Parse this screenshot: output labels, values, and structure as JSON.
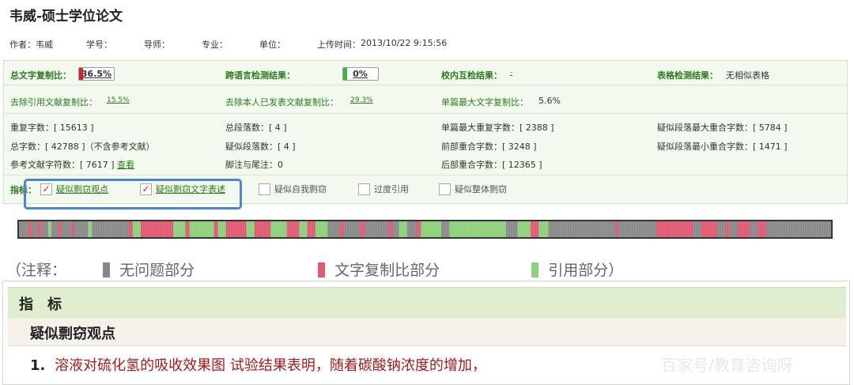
{
  "doc": {
    "title": "韦威-硕士学位论文",
    "author_label": "作者：",
    "author": "韦威",
    "id_label": "学号：",
    "advisor_label": "导师：",
    "major_label": "专业：",
    "unit_label": "单位：",
    "upload_label": "上传时间：",
    "upload_time": "2013/10/22 9:15:56"
  },
  "summary": {
    "total_copy_label": "总文字复制比：",
    "total_copy_value": "36.5%",
    "cross_lang_label": "跨语言检测结果：",
    "cross_lang_value": "0%",
    "campus_label": "校内互检结果：",
    "campus_value": "-",
    "table_label": "表格检测结果：",
    "table_value": "无相似表格",
    "remove_ref_label": "去除引用文献复制比：",
    "remove_ref_value": "15.5%",
    "remove_self_label": "去除本人已发表文献复制比：",
    "remove_self_value": "29.3%",
    "single_max_label": "单篇最大文字复制比：",
    "single_max_value": "5.6%"
  },
  "stats": {
    "dup_chars": "重复字数：[ 15613 ]",
    "total_paras": "总段落数：[ 4 ]",
    "single_max_dup": "单篇最大重复字数：[ 2388 ]",
    "max_para_overlap": "疑似段落最大重合字数：[ 5784 ]",
    "total_chars": "总字数：[ 42788 ]（不含参考文献）",
    "suspect_paras": "疑似段落数：[ 4 ]",
    "front_overlap": "前部重合字数：[ 3248 ]",
    "min_para_overlap": "疑似段落最小重合字数：[ 1471 ]",
    "ref_chars": "参考文献字符数：[ 7617 ]",
    "view_link": "查看",
    "footnote": "脚注与尾注：0",
    "back_overlap": "后部重合字数：[ 12365 ]"
  },
  "indicators": {
    "label": "指标：",
    "items": [
      {
        "label": "疑似剽窃观点",
        "checked": "✓"
      },
      {
        "label": "疑似剽窃文字表述",
        "checked": "✓"
      },
      {
        "label": "疑似自我剽窃",
        "checked": ""
      },
      {
        "label": "过度引用",
        "checked": ""
      },
      {
        "label": "疑似整体剽窃",
        "checked": ""
      }
    ]
  },
  "legend": {
    "open": "（注释：",
    "gray": "无问题部分",
    "red": "文字复制比部分",
    "green": "引用部分）"
  },
  "colors": {
    "gray": "#8a8a8a",
    "red": "#e05a74",
    "green": "#8fd07d",
    "accent_green": "#2b7a1e",
    "highlight_blue": "#4a86c8"
  },
  "section": {
    "heading": "指　标",
    "subheading": "疑似剽窃观点",
    "item_number": "1.",
    "item_text": "溶液对硫化氢的吸收效果图 试验结果表明，随着碳酸钠浓度的增加，"
  },
  "watermark": "百家号/教育咨询呀",
  "distribution_bar": [
    {
      "type": "gray",
      "start": 0.0,
      "end": 0.012
    },
    {
      "type": "red",
      "start": 0.012,
      "end": 0.016
    },
    {
      "type": "gray",
      "start": 0.016,
      "end": 0.024
    },
    {
      "type": "red",
      "start": 0.024,
      "end": 0.028
    },
    {
      "type": "gray",
      "start": 0.028,
      "end": 0.036
    },
    {
      "type": "green",
      "start": 0.036,
      "end": 0.04
    },
    {
      "type": "gray",
      "start": 0.04,
      "end": 0.048
    },
    {
      "type": "red",
      "start": 0.048,
      "end": 0.052
    },
    {
      "type": "gray",
      "start": 0.052,
      "end": 0.065
    },
    {
      "type": "red",
      "start": 0.065,
      "end": 0.068
    },
    {
      "type": "gray",
      "start": 0.068,
      "end": 0.085
    },
    {
      "type": "green",
      "start": 0.085,
      "end": 0.09
    },
    {
      "type": "gray",
      "start": 0.09,
      "end": 0.135
    },
    {
      "type": "red",
      "start": 0.135,
      "end": 0.14
    },
    {
      "type": "green",
      "start": 0.14,
      "end": 0.15
    },
    {
      "type": "red",
      "start": 0.15,
      "end": 0.19
    },
    {
      "type": "green",
      "start": 0.19,
      "end": 0.205
    },
    {
      "type": "red",
      "start": 0.205,
      "end": 0.21
    },
    {
      "type": "green",
      "start": 0.21,
      "end": 0.24
    },
    {
      "type": "red",
      "start": 0.24,
      "end": 0.245
    },
    {
      "type": "green",
      "start": 0.245,
      "end": 0.255
    },
    {
      "type": "red",
      "start": 0.255,
      "end": 0.28
    },
    {
      "type": "green",
      "start": 0.28,
      "end": 0.29
    },
    {
      "type": "red",
      "start": 0.29,
      "end": 0.31
    },
    {
      "type": "green",
      "start": 0.31,
      "end": 0.33
    },
    {
      "type": "red",
      "start": 0.33,
      "end": 0.345
    },
    {
      "type": "green",
      "start": 0.345,
      "end": 0.355
    },
    {
      "type": "red",
      "start": 0.355,
      "end": 0.365
    },
    {
      "type": "green",
      "start": 0.365,
      "end": 0.38
    },
    {
      "type": "gray",
      "start": 0.38,
      "end": 0.395
    },
    {
      "type": "red",
      "start": 0.395,
      "end": 0.4
    },
    {
      "type": "gray",
      "start": 0.4,
      "end": 0.42
    },
    {
      "type": "red",
      "start": 0.42,
      "end": 0.426
    },
    {
      "type": "gray",
      "start": 0.426,
      "end": 0.455
    },
    {
      "type": "red",
      "start": 0.455,
      "end": 0.46
    },
    {
      "type": "gray",
      "start": 0.46,
      "end": 0.468
    },
    {
      "type": "green",
      "start": 0.468,
      "end": 0.478
    },
    {
      "type": "gray",
      "start": 0.478,
      "end": 0.49
    },
    {
      "type": "red",
      "start": 0.49,
      "end": 0.495
    },
    {
      "type": "green",
      "start": 0.495,
      "end": 0.52
    },
    {
      "type": "gray",
      "start": 0.52,
      "end": 0.53
    },
    {
      "type": "green",
      "start": 0.53,
      "end": 0.6
    },
    {
      "type": "gray",
      "start": 0.6,
      "end": 0.614
    },
    {
      "type": "green",
      "start": 0.614,
      "end": 0.63
    },
    {
      "type": "red",
      "start": 0.63,
      "end": 0.64
    },
    {
      "type": "green",
      "start": 0.64,
      "end": 0.652
    },
    {
      "type": "gray",
      "start": 0.652,
      "end": 0.735
    },
    {
      "type": "red",
      "start": 0.735,
      "end": 0.738
    },
    {
      "type": "gray",
      "start": 0.738,
      "end": 0.785
    },
    {
      "type": "red",
      "start": 0.785,
      "end": 0.83
    },
    {
      "type": "gray",
      "start": 0.83,
      "end": 0.84
    },
    {
      "type": "red",
      "start": 0.84,
      "end": 0.86
    },
    {
      "type": "gray",
      "start": 0.86,
      "end": 0.87
    },
    {
      "type": "red",
      "start": 0.87,
      "end": 0.875
    },
    {
      "type": "gray",
      "start": 0.875,
      "end": 0.885
    },
    {
      "type": "red",
      "start": 0.885,
      "end": 0.9
    },
    {
      "type": "gray",
      "start": 0.9,
      "end": 0.91
    },
    {
      "type": "red",
      "start": 0.91,
      "end": 0.92
    },
    {
      "type": "gray",
      "start": 0.92,
      "end": 1.0
    }
  ]
}
